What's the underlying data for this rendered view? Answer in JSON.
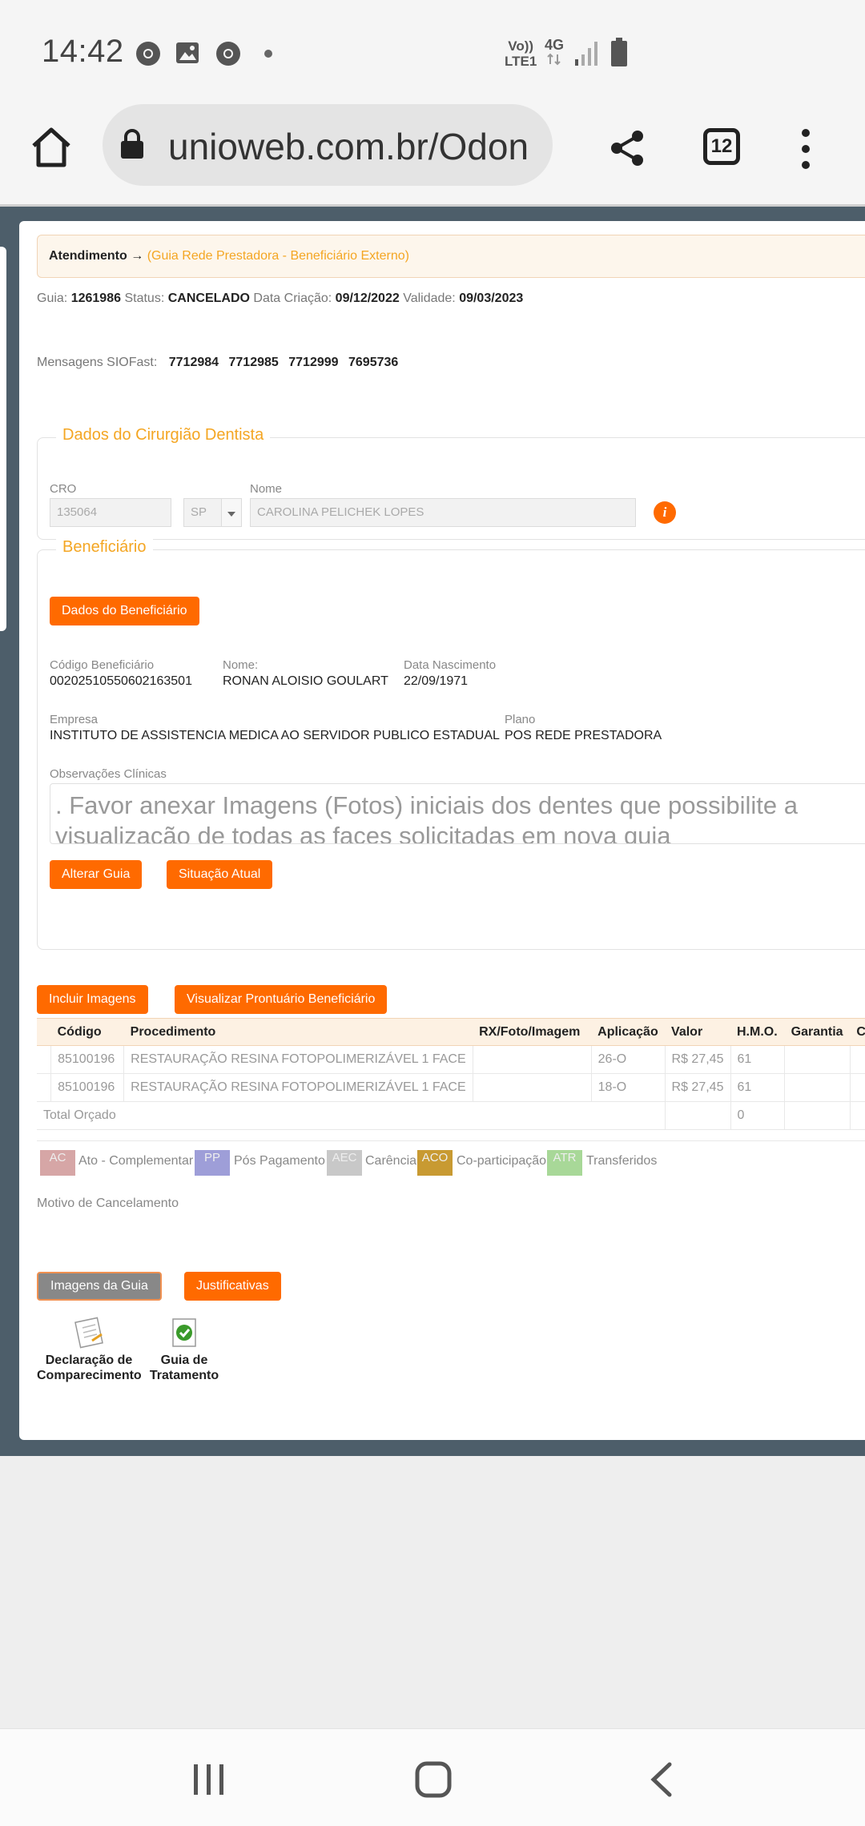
{
  "status_bar": {
    "time": "14:42",
    "net_top": "Vo))",
    "net_bottom": "LTE1",
    "net_type": "4G"
  },
  "browser": {
    "url": "unioweb.com.br/Odon",
    "tab_count": "12"
  },
  "breadcrumb": {
    "main": "Atendimento",
    "arrow": "→",
    "sub": "(Guia Rede Prestadora - Beneficiário Externo)"
  },
  "guia_info": {
    "guia_label": "Guia:",
    "guia_value": "1261986",
    "status_label": "Status:",
    "status_value": "CANCELADO",
    "criacao_label": "Data Criação:",
    "criacao_value": "09/12/2022",
    "validade_label": "Validade:",
    "validade_value": "09/03/2023"
  },
  "mensagens": {
    "label": "Mensagens SIOFast:",
    "values": [
      "7712984",
      "7712985",
      "7712999",
      "7695736"
    ]
  },
  "dentista": {
    "legend": "Dados do Cirurgião Dentista",
    "cro_label": "CRO",
    "cro_value": "135064",
    "uf_value": "SP",
    "nome_label": "Nome",
    "nome_value": "CAROLINA PELICHEK LOPES",
    "info_glyph": "i"
  },
  "beneficiario": {
    "legend": "Beneficiário",
    "dados_button": "Dados do Beneficiário",
    "codigo_label": "Código Beneficiário",
    "codigo_value": "00202510550602163501",
    "nome_label": "Nome:",
    "nome_value": "RONAN ALOISIO GOULART",
    "nasc_label": "Data Nascimento",
    "nasc_value": "22/09/1971",
    "empresa_label": "Empresa",
    "empresa_value": "INSTITUTO DE ASSISTENCIA MEDICA AO SERVIDOR PUBLICO ESTADUAL",
    "plano_label": "Plano",
    "plano_value": "POS REDE PRESTADORA",
    "obs_label": "Observações Clínicas",
    "obs_line1": ". Favor anexar Imagens (Fotos) iniciais dos dentes que possibilite a",
    "obs_line2": "visualização de todas as faces solicitadas em nova guia",
    "alterar_button": "Alterar Guia",
    "situacao_button": "Situação Atual"
  },
  "actions": {
    "incluir_button": "Incluir Imagens",
    "prontuario_button": "Visualizar Prontuário Beneficiário"
  },
  "table": {
    "headers": [
      "Código",
      "Procedimento",
      "RX/Foto/Imagem",
      "Aplicação",
      "Valor",
      "H.M.O.",
      "Garantia",
      "Car"
    ],
    "rows": [
      [
        "85100196",
        "RESTAURAÇÃO RESINA FOTOPOLIMERIZÁVEL 1 FACE",
        "",
        "26-O",
        "R$ 27,45",
        "61",
        ""
      ],
      [
        "85100196",
        "RESTAURAÇÃO RESINA FOTOPOLIMERIZÁVEL 1 FACE",
        "",
        "18-O",
        "R$ 27,45",
        "61",
        ""
      ]
    ],
    "total_label": "Total Orçado",
    "total_hmo": "0"
  },
  "legend": [
    {
      "code": "AC",
      "label": "Ato - Complementar",
      "color": "#d6a6a6"
    },
    {
      "code": "PP",
      "label": "Pós Pagamento",
      "color": "#9e9ed8"
    },
    {
      "code": "AEC",
      "label": "Carência",
      "color": "#c8c8c8"
    },
    {
      "code": "ACO",
      "label": "Co-participação",
      "color": "#c89a32"
    },
    {
      "code": "ATR",
      "label": "Transferidos",
      "color": "#a8d898"
    }
  ],
  "cancelamento": {
    "label": "Motivo de Cancelamento"
  },
  "bottom": {
    "imagens_button": "Imagens da Guia",
    "justificativas_button": "Justificativas",
    "declaracao_line1": "Declaração de",
    "declaracao_line2": "Comparecimento",
    "guia_line1": "Guia de",
    "guia_line2": "Tratamento"
  },
  "colors": {
    "accent": "#ff6a00",
    "legend_text": "#f4a623",
    "page_bg": "#4d5e6a"
  }
}
